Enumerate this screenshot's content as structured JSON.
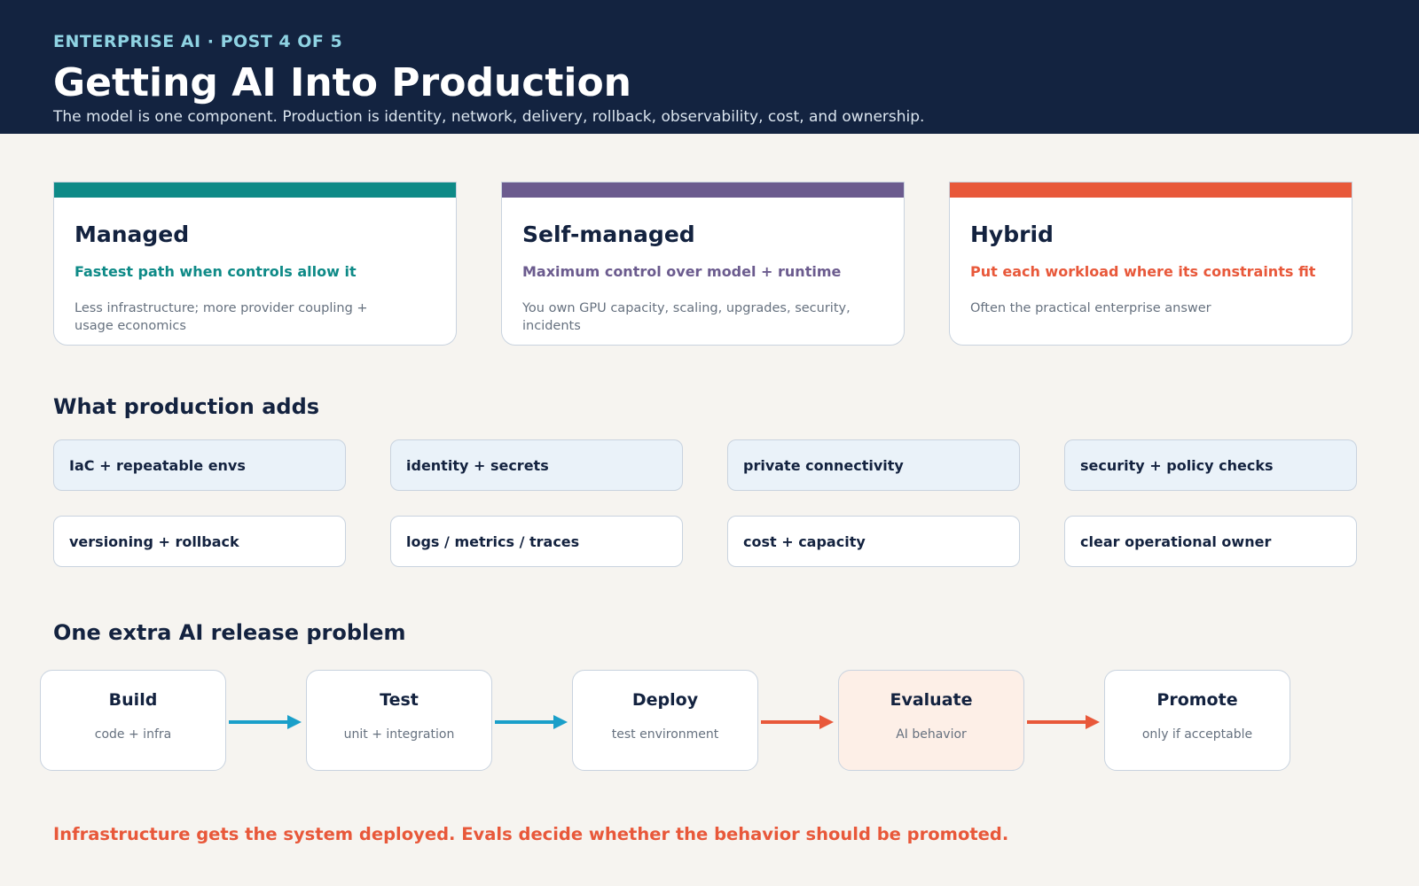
{
  "header": {
    "eyebrow": "ENTERPRISE AI · POST 4 OF 5",
    "title": "Getting AI Into Production",
    "subtitle": "The model is one component. Production is identity, network, delivery, rollback, observability, cost, and ownership."
  },
  "options": [
    {
      "title": "Managed",
      "tagline": "Fastest path when controls allow it",
      "description": "Less infrastructure; more provider coupling + usage economics",
      "color": "#0e8a87"
    },
    {
      "title": "Self-managed",
      "tagline": "Maximum control over model + runtime",
      "description": "You own GPU capacity, scaling, upgrades, security, incidents",
      "color": "#6b5b8e"
    },
    {
      "title": "Hybrid",
      "tagline": "Put each workload where its constraints fit",
      "description": "Often the practical enterprise answer",
      "color": "#e8583a"
    }
  ],
  "production_adds": {
    "heading": "What production adds",
    "items": [
      "IaC + repeatable envs",
      "identity + secrets",
      "private connectivity",
      "security + policy checks",
      "versioning + rollback",
      "logs / metrics / traces",
      "cost + capacity",
      "clear operational owner"
    ]
  },
  "release": {
    "heading": "One extra AI release problem",
    "stages": [
      {
        "title": "Build",
        "subtitle": "code + infra"
      },
      {
        "title": "Test",
        "subtitle": "unit + integration"
      },
      {
        "title": "Deploy",
        "subtitle": "test environment"
      },
      {
        "title": "Evaluate",
        "subtitle": "AI behavior"
      },
      {
        "title": "Promote",
        "subtitle": "only if acceptable"
      }
    ],
    "arrow_colors": [
      "#1a9fc9",
      "#1a9fc9",
      "#e8583a",
      "#e8583a"
    ]
  },
  "footer": {
    "note": "Infrastructure gets the system deployed. Evals decide whether the behavior should be promoted."
  }
}
